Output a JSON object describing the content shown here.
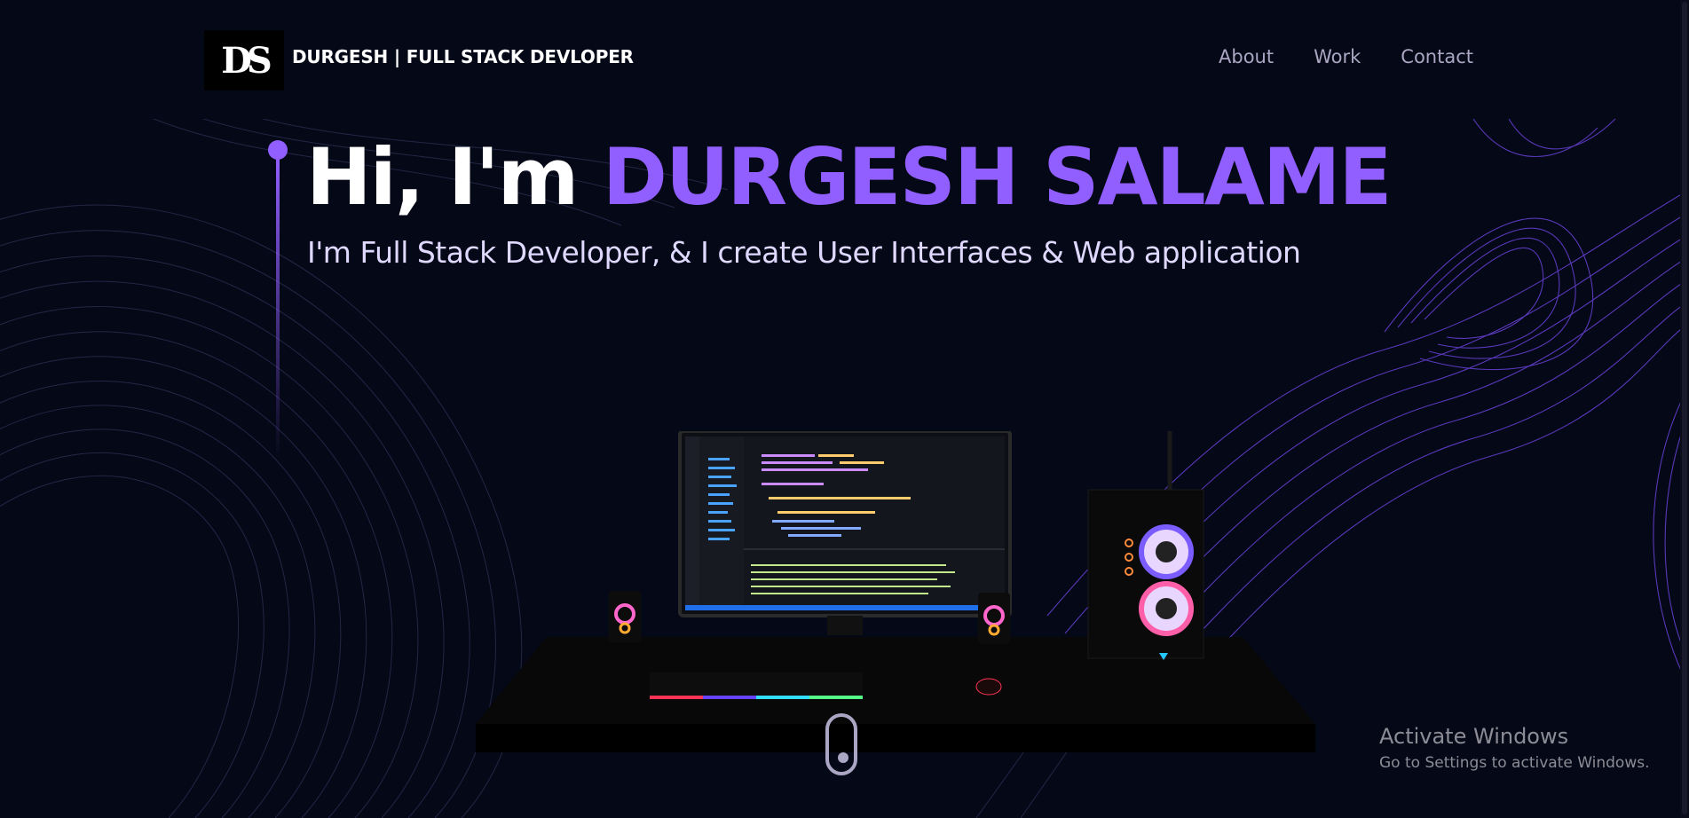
{
  "header": {
    "logo_text": "DS",
    "brand": "DURGESH | FULL STACK DEVLOPER",
    "nav": [
      {
        "label": "About"
      },
      {
        "label": "Work"
      },
      {
        "label": "Contact"
      }
    ]
  },
  "hero": {
    "greeting": "Hi, I'm",
    "name": "DURGESH SALAME",
    "subtitle": "I'm Full Stack Developer, & I create User Interfaces & Web application"
  },
  "watermark": {
    "title": "Activate Windows",
    "subtitle": "Go to Settings to activate Windows."
  },
  "colors": {
    "background": "#050816",
    "accent": "#915eff",
    "nav_text": "#aaa6c3",
    "white": "#ffffff"
  },
  "icons": {
    "scroll": "mouse-scroll-icon",
    "logo": "ds-logo-icon"
  }
}
